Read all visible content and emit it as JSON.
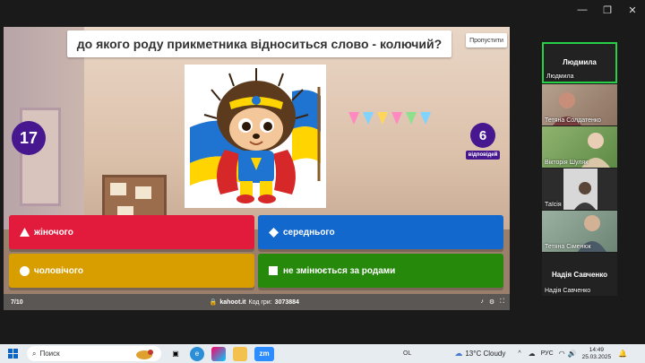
{
  "window_controls": {
    "minimize": "—",
    "maximize": "❐",
    "close": "✕"
  },
  "quiz": {
    "question": "до якого роду прикметника відноситься слово - колючий?",
    "skip_label": "Пропустити",
    "timer": "17",
    "answers_count": "6",
    "answers_label": "відповідей",
    "answers": [
      {
        "label": "жіночого",
        "shape": "triangle",
        "color": "#e21b3c"
      },
      {
        "label": "середнього",
        "shape": "diamond",
        "color": "#1368ce"
      },
      {
        "label": "чоловічого",
        "shape": "circle",
        "color": "#d89e00"
      },
      {
        "label": "не змінюється за родами",
        "shape": "square",
        "color": "#26890c"
      }
    ],
    "progress": "7/10",
    "site": "kahoot.it",
    "pin_label": "Код гри:",
    "pin": "3073884"
  },
  "participants": [
    {
      "name": "Людмила",
      "caption": "Людмила",
      "active": true
    },
    {
      "name": "Тетяна Солдатенко"
    },
    {
      "name": "Вікторія Шуляк"
    },
    {
      "name": "Таїсія"
    },
    {
      "name": "Тетяна Сіменюк"
    },
    {
      "name": "Надія Савченко",
      "caption": "Надія Савченко"
    }
  ],
  "taskbar": {
    "search_placeholder": "Поиск",
    "zoom_label": "zm",
    "ol_label": "OL",
    "weather": "13°C  Cloudy",
    "lang": "РУС",
    "time": "14:49",
    "date": "25.03.2025"
  }
}
